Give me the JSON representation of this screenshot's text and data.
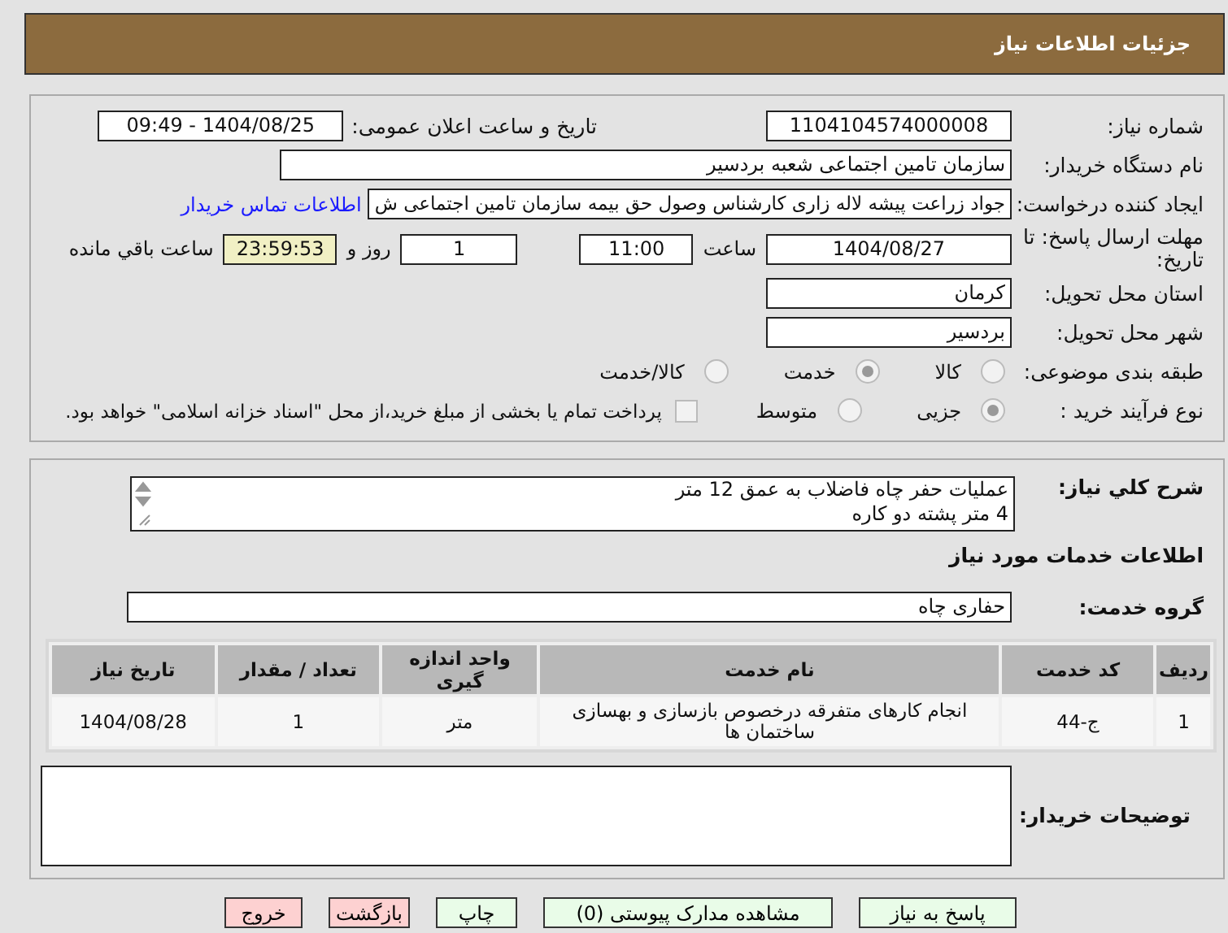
{
  "header": {
    "title": "جزئیات اطلاعات نیاز"
  },
  "need_number": {
    "label": "شماره نیاز:",
    "value": "1104104574000008"
  },
  "announce": {
    "label": "تاریخ و ساعت اعلان عمومی:",
    "value": "1404/08/25 - 09:49"
  },
  "buyer": {
    "label": "نام دستگاه خریدار:",
    "value": "سازمان تامین اجتماعی شعبه بردسیر"
  },
  "requester": {
    "label": "ایجاد کننده درخواست:",
    "value": "جواد زراعت پیشه لاله زاری کارشناس وصول حق بیمه سازمان تامین اجتماعی ش",
    "link": "اطلاعات تماس خریدار"
  },
  "deadline": {
    "label": "مهلت ارسال پاسخ: تا تاریخ:",
    "date": "1404/08/27",
    "time_label": "ساعت",
    "time": "11:00",
    "days": "1",
    "days_label": "روز و",
    "remaining": "23:59:53",
    "remaining_label": "ساعت باقي مانده"
  },
  "province": {
    "label": "استان محل تحویل:",
    "value": "کرمان"
  },
  "city": {
    "label": "شهر محل تحویل:",
    "value": "بردسیر"
  },
  "category": {
    "label": "طبقه بندی موضوعی:",
    "options": [
      {
        "label": "کالا",
        "selected": false
      },
      {
        "label": "خدمت",
        "selected": true
      },
      {
        "label": "کالا/خدمت",
        "selected": false
      }
    ]
  },
  "process": {
    "label": "نوع فرآیند خرید :",
    "options": [
      {
        "label": "جزیی",
        "selected": true
      },
      {
        "label": "متوسط",
        "selected": false
      }
    ],
    "payment": {
      "checked": false,
      "text": "پرداخت تمام یا بخشی از مبلغ خرید،از محل \"اسناد خزانه اسلامی\" خواهد بود."
    }
  },
  "description": {
    "label": "شرح کلي نیاز:",
    "lines": [
      "عملیات حفر چاه فاضلاب به عمق 12 متر",
      "4 متر پشته دو کاره"
    ]
  },
  "services_title": "اطلاعات خدمات مورد نیاز",
  "service_group": {
    "label": "گروه خدمت:",
    "value": "حفاری چاه"
  },
  "table": {
    "columns": [
      "ردیف",
      "کد خدمت",
      "نام خدمت",
      "واحد اندازه گیری",
      "تعداد / مقدار",
      "تاریخ نیاز"
    ],
    "rows": [
      [
        "1",
        "ج-44",
        "انجام کارهای متفرقه درخصوص بازسازی و بهسازی ساختمان ها",
        "متر",
        "1",
        "1404/08/28"
      ]
    ]
  },
  "notes": {
    "label": "توضیحات خریدار:"
  },
  "buttons": [
    {
      "label": "پاسخ به نیاز",
      "kind": "go"
    },
    {
      "label": "مشاهده مدارک پیوستی (0)",
      "kind": "go"
    },
    {
      "label": "چاپ",
      "kind": "go"
    },
    {
      "label": "بازگشت",
      "kind": "stop"
    },
    {
      "label": "خروج",
      "kind": "stop"
    }
  ]
}
